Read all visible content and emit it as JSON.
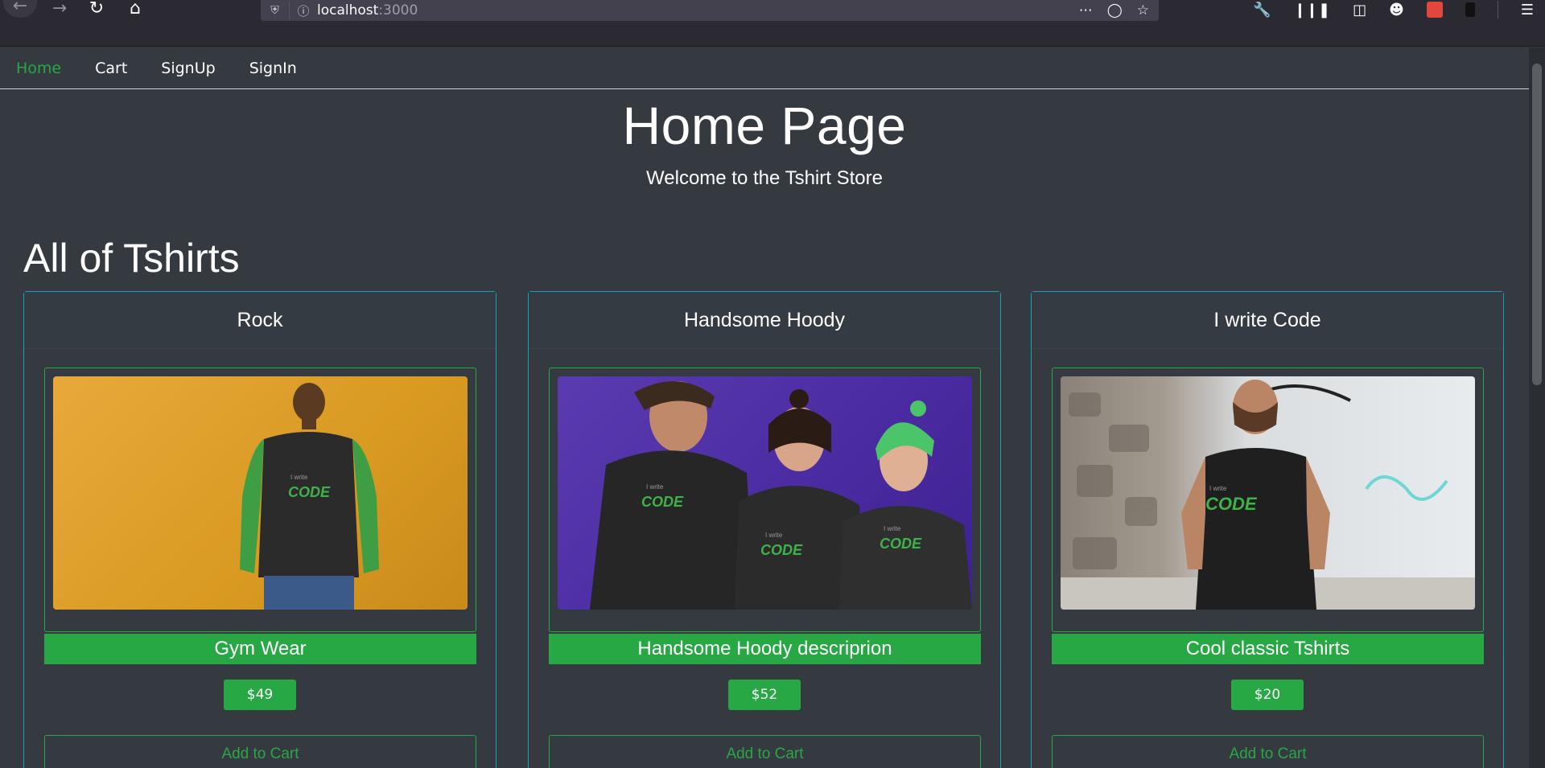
{
  "browser": {
    "url_host": "localhost",
    "url_port": ":3000"
  },
  "nav": {
    "items": [
      {
        "label": "Home",
        "active": true
      },
      {
        "label": "Cart",
        "active": false
      },
      {
        "label": "SignUp",
        "active": false
      },
      {
        "label": "SignIn",
        "active": false
      }
    ]
  },
  "hero": {
    "title": "Home Page",
    "subtitle": "Welcome to the Tshirt Store"
  },
  "section": {
    "title": "All of Tshirts"
  },
  "products": [
    {
      "name": "Rock",
      "description": "Gym Wear",
      "price": "$49",
      "cart_label": "Add to Cart",
      "image_tone": "yellow"
    },
    {
      "name": "Handsome Hoody",
      "description": "Handsome Hoody descriprion",
      "price": "$52",
      "cart_label": "Add to Cart",
      "image_tone": "purple"
    },
    {
      "name": "I write Code",
      "description": "Cool classic Tshirts",
      "price": "$20",
      "cart_label": "Add to Cart",
      "image_tone": "wall"
    }
  ],
  "shirt_print": {
    "line1": "I write",
    "line2": "CODE"
  },
  "colors": {
    "background": "#343a40",
    "accent_green": "#28a745",
    "card_border": "#17a2b8"
  }
}
